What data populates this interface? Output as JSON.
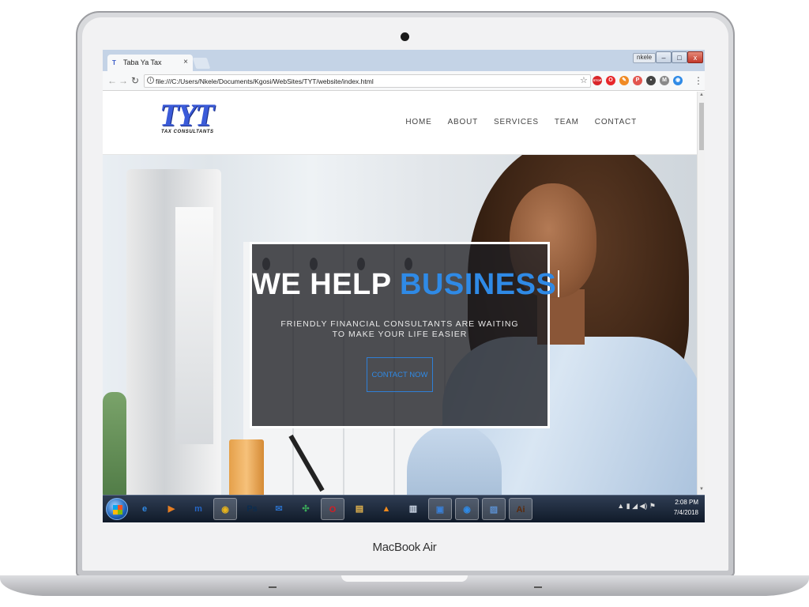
{
  "device": {
    "brand_label": "MacBook Air"
  },
  "browser": {
    "tab_title": "Taba Ya Tax",
    "tab_close": "×",
    "address": "file:///C:/Users/Nkele/Documents/Kgosi/WebSites/TYT/website/index.html",
    "user_badge": "nkele",
    "window_controls": {
      "minimize": "–",
      "maximize": "□",
      "close": "x"
    },
    "extensions": [
      {
        "name": "stop-icon",
        "label": "STOP",
        "color": "#d9262a"
      },
      {
        "name": "opera-icon",
        "label": "O",
        "color": "#e7262a"
      },
      {
        "name": "pencil-icon",
        "label": "✎",
        "color": "#f08a24"
      },
      {
        "name": "pinterest-icon",
        "label": "P",
        "color": "#e2554f"
      },
      {
        "name": "bookmark-icon",
        "label": "▪",
        "color": "#444444"
      },
      {
        "name": "gmail-icon",
        "label": "M",
        "color": "#8a8a8a"
      },
      {
        "name": "chrome-icon",
        "label": "◉",
        "color": "#2f8ae6"
      }
    ]
  },
  "site": {
    "logo": {
      "mark": "TYT",
      "tagline": "TAX CONSULTANTS"
    },
    "nav": [
      "HOME",
      "ABOUT",
      "SERVICES",
      "TEAM",
      "CONTACT"
    ],
    "hero": {
      "title_plain": "WE HELP ",
      "title_accent": "BUSINESS",
      "subtitle": "FRIENDLY FINANCIAL CONSULTANTS ARE WAITING TO MAKE YOUR LIFE EASIER",
      "cta": "CONTACT NOW"
    },
    "colors": {
      "accent": "#2f8ae6",
      "logo": "#3b5bd9"
    }
  },
  "taskbar": {
    "apps": [
      {
        "name": "ie-icon",
        "label": "e",
        "color": "#2f8ae6"
      },
      {
        "name": "media-player-icon",
        "label": "▶",
        "color": "#e57d22"
      },
      {
        "name": "maxthon-icon",
        "label": "m",
        "color": "#2565c4"
      },
      {
        "name": "chrome-taskbar-icon",
        "label": "◉",
        "color": "#e8b41c",
        "active": true
      },
      {
        "name": "photoshop-icon",
        "label": "Ps",
        "color": "#0b2c4f"
      },
      {
        "name": "thunderbird-icon",
        "label": "✉",
        "color": "#2a6dc2"
      },
      {
        "name": "xampp-icon",
        "label": "✣",
        "color": "#3bab5a"
      },
      {
        "name": "opera-taskbar-icon",
        "label": "O",
        "color": "#d41e24",
        "active": true
      },
      {
        "name": "explorer-icon",
        "label": "▤",
        "color": "#e3b34e"
      },
      {
        "name": "vlc-icon",
        "label": "▲",
        "color": "#f08a1c"
      },
      {
        "name": "notepad-icon",
        "label": "▥",
        "color": "#cfd9e8"
      },
      {
        "name": "app-window-icon",
        "label": "▣",
        "color": "#3a7fd4",
        "active": true
      },
      {
        "name": "chrome-taskbar-icon-2",
        "label": "◉",
        "color": "#2f8ae6",
        "active": true
      },
      {
        "name": "image-viewer-icon",
        "label": "▨",
        "color": "#5c8fcf",
        "active": true
      },
      {
        "name": "illustrator-icon",
        "label": "Ai",
        "color": "#5a2a0c",
        "active": true
      }
    ],
    "tray_icons": "▲  ▮  ◢  ◀)  ⚑",
    "time": "2:08 PM",
    "date": "7/4/2018"
  }
}
